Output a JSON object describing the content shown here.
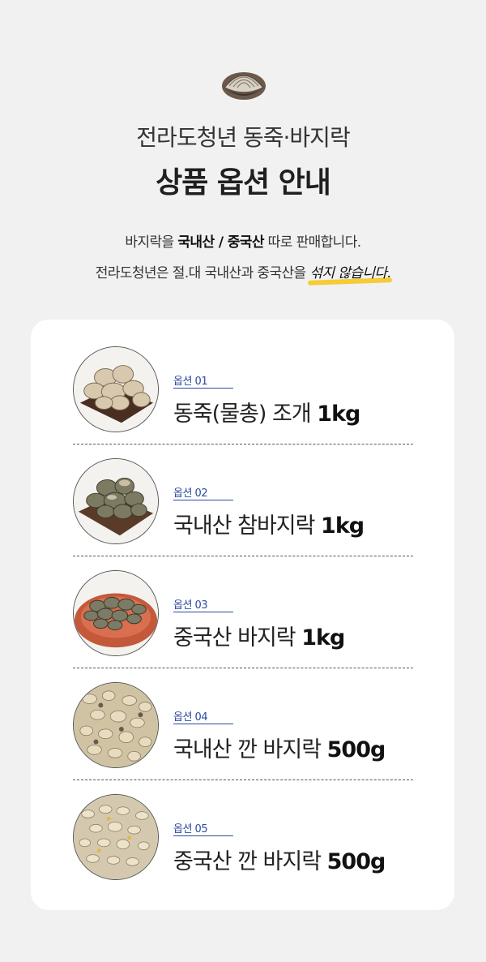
{
  "header": {
    "title_line1": "전라도청년 동죽·바지락",
    "title_line2": "상품 옵션 안내"
  },
  "description": {
    "line1_prefix": "바지락을 ",
    "line1_bold": "국내산 / 중국산",
    "line1_suffix": " 따로 판매합니다.",
    "line2_prefix": "전라도청년은 절.대 국내산과 중국산을",
    "line2_handwritten": "섞지 않습니다."
  },
  "colors": {
    "background": "#f1f1f1",
    "card": "#ffffff",
    "label_blue": "#2b4a9e",
    "highlight_yellow": "#f5cc35"
  },
  "options": [
    {
      "label": "옵션 01",
      "name": "동죽(물총) 조개 ",
      "weight": "1kg",
      "image": "clams-on-wooden-board-photo"
    },
    {
      "label": "옵션 02",
      "name": "국내산 참바지락 ",
      "weight": "1kg",
      "image": "manila-clams-on-board-photo"
    },
    {
      "label": "옵션 03",
      "name": "중국산 바지락 ",
      "weight": "1kg",
      "image": "clams-on-red-plate-photo"
    },
    {
      "label": "옵션 04",
      "name": "국내산 깐 바지락 ",
      "weight": "500g",
      "image": "shucked-clam-meat-photo"
    },
    {
      "label": "옵션 05",
      "name": "중국산 깐 바지락 ",
      "weight": "500g",
      "image": "shucked-clam-meat-photo"
    }
  ]
}
